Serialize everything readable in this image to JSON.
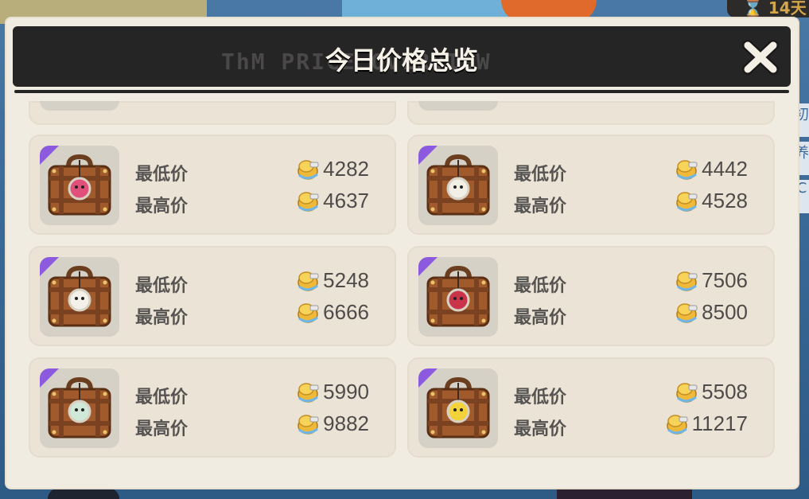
{
  "background": {
    "timer_text": "14天",
    "side_tabs": [
      "初",
      "养",
      "C"
    ]
  },
  "modal": {
    "title": "今日价格总览",
    "header_deco": "ThM PRICE OVERVIEW",
    "close_icon": "close-x-icon"
  },
  "labels": {
    "min": "最低价",
    "max": "最高价"
  },
  "currency_icon": "gold-coin-icon",
  "items": [
    {
      "badge_icon": "pink-creature-badge",
      "badge_color": "#e0507a",
      "min": "4282",
      "max": "4637"
    },
    {
      "badge_icon": "white-rabbit-badge",
      "badge_color": "#f2efe6",
      "min": "4442",
      "max": "4528"
    },
    {
      "badge_icon": "white-cat-badge",
      "badge_color": "#f3f1ea",
      "min": "5248",
      "max": "6666"
    },
    {
      "badge_icon": "red-fox-badge",
      "badge_color": "#c9344a",
      "min": "7506",
      "max": "8500"
    },
    {
      "badge_icon": "green-deer-badge",
      "badge_color": "#cfe8d8",
      "min": "5990",
      "max": "9882"
    },
    {
      "badge_icon": "yellow-duck-badge",
      "badge_color": "#f3d23a",
      "min": "5508",
      "max": "11217"
    }
  ],
  "colors": {
    "rarity": "#8b5adf",
    "header": "#262525",
    "panel": "#f1ece2",
    "card": "#ebe4d6"
  }
}
